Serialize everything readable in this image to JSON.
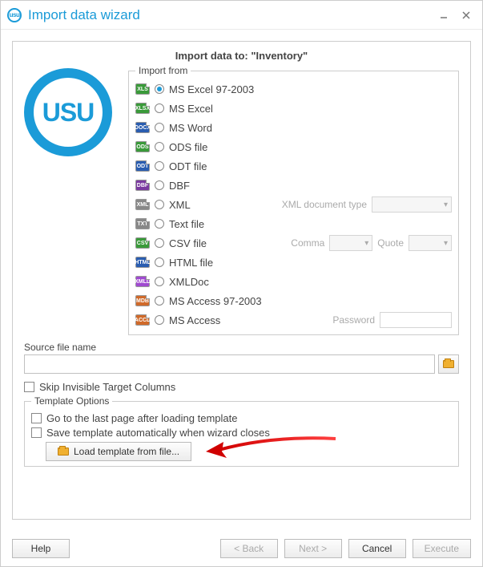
{
  "window": {
    "title": "Import data wizard",
    "app_icon_text": "usu"
  },
  "panel": {
    "heading": "Import data to: \"Inventory\"",
    "logo_text": "USU",
    "import_from_legend": "Import from",
    "formats": [
      {
        "icon_tag": "XLS",
        "icon_cls": "ic-xls",
        "label": "MS Excel 97-2003",
        "selected": true
      },
      {
        "icon_tag": "XLSX",
        "icon_cls": "ic-xlsx",
        "label": "MS Excel"
      },
      {
        "icon_tag": "DOCX",
        "icon_cls": "ic-doc",
        "label": "MS Word"
      },
      {
        "icon_tag": "ODS",
        "icon_cls": "ic-ods",
        "label": "ODS file"
      },
      {
        "icon_tag": "ODT",
        "icon_cls": "ic-odt",
        "label": "ODT file"
      },
      {
        "icon_tag": "DBF",
        "icon_cls": "ic-dbf",
        "label": "DBF"
      },
      {
        "icon_tag": "XML",
        "icon_cls": "ic-xml",
        "label": "XML",
        "extra": "xmltype"
      },
      {
        "icon_tag": "TXT",
        "icon_cls": "ic-txt",
        "label": "Text file"
      },
      {
        "icon_tag": "CSV",
        "icon_cls": "ic-csv",
        "label": "CSV file",
        "extra": "csv"
      },
      {
        "icon_tag": "HTML",
        "icon_cls": "ic-html",
        "label": "HTML file"
      },
      {
        "icon_tag": "XMLD",
        "icon_cls": "ic-xmld",
        "label": "XMLDoc"
      },
      {
        "icon_tag": "MDB",
        "icon_cls": "ic-mdb",
        "label": "MS Access 97-2003"
      },
      {
        "icon_tag": "ACCD",
        "icon_cls": "ic-accd",
        "label": "MS Access",
        "extra": "password"
      }
    ],
    "xml_type_label": "XML document type",
    "csv_comma_label": "Comma",
    "csv_quote_label": "Quote",
    "password_label": "Password",
    "source_label": "Source file name",
    "skip_invisible_label": "Skip Invisible Target Columns",
    "template_legend": "Template Options",
    "go_last_label": "Go to the last page after loading template",
    "save_auto_label": "Save template automatically when wizard closes",
    "load_template_label": "Load template from file..."
  },
  "footer": {
    "help": "Help",
    "back": "< Back",
    "next": "Next >",
    "cancel": "Cancel",
    "execute": "Execute"
  }
}
